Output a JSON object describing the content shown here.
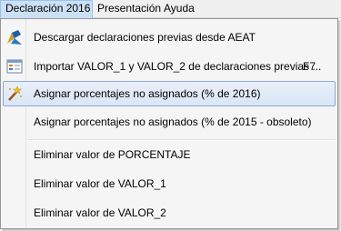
{
  "menubar": {
    "items": [
      {
        "label": "Declaración 2016"
      },
      {
        "label": "Presentación"
      },
      {
        "label": "Ayuda"
      }
    ]
  },
  "menu": {
    "items": [
      {
        "label": "Descargar declaraciones previas desde AEAT",
        "icon": "aeat-logo-icon"
      },
      {
        "label": "Importar VALOR_1 y VALOR_2 de declaraciones previas ...",
        "shortcut": "F7",
        "icon": "import-table-icon"
      },
      {
        "label": "Asignar porcentajes no asignados (% de 2016)",
        "icon": "magic-wand-icon"
      },
      {
        "label": "Asignar porcentajes no asignados (% de 2015 - obsoleto)"
      },
      {
        "label": "Eliminar valor de PORCENTAJE"
      },
      {
        "label": "Eliminar valor de VALOR_1"
      },
      {
        "label": "Eliminar valor de VALOR_2"
      }
    ]
  }
}
